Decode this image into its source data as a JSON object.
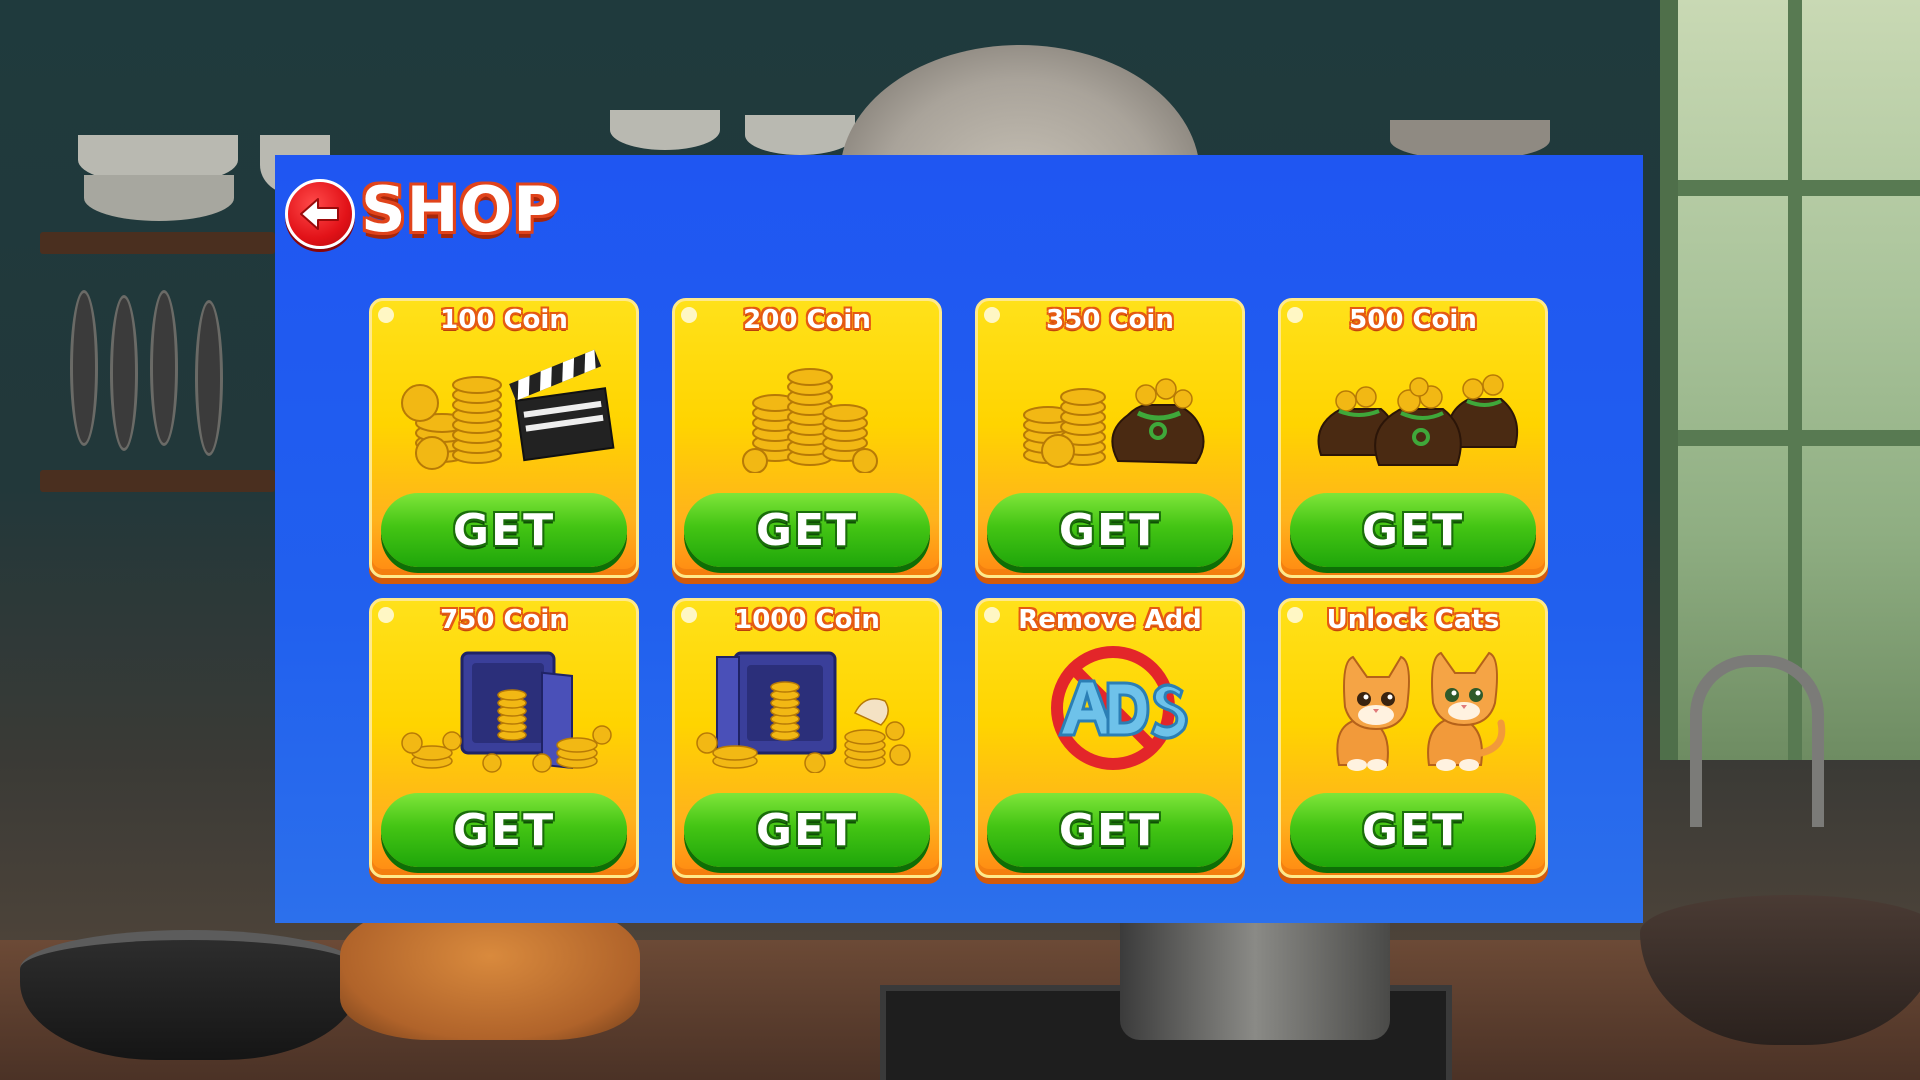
{
  "shop": {
    "title": "SHOP",
    "back_icon": "arrow-left-icon",
    "accent": "#1f56f2",
    "items": [
      {
        "title": "100 Coin",
        "art": "coins-with-clapperboard",
        "button": "GET"
      },
      {
        "title": "200 Coin",
        "art": "coin-stacks",
        "button": "GET"
      },
      {
        "title": "350 Coin",
        "art": "coins-with-money-bag",
        "button": "GET"
      },
      {
        "title": "500 Coin",
        "art": "money-bags",
        "button": "GET"
      },
      {
        "title": "750 Coin",
        "art": "safe-with-coins",
        "button": "GET"
      },
      {
        "title": "1000 Coin",
        "art": "open-safe-with-coins",
        "button": "GET"
      },
      {
        "title": "Remove Add",
        "art": "no-ads",
        "button": "GET"
      },
      {
        "title": "Unlock Cats",
        "art": "two-cats",
        "button": "GET"
      }
    ]
  }
}
